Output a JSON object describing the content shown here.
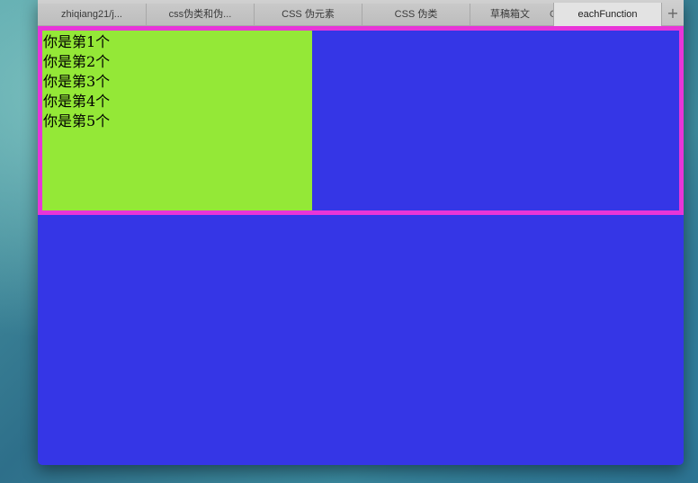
{
  "tabs": [
    {
      "label": "zhiqiang21/j..."
    },
    {
      "label": "css伪类和伪..."
    },
    {
      "label": "CSS 伪元素"
    },
    {
      "label": "CSS 伪类"
    },
    {
      "label": "草稿箱文",
      "extra": "C"
    },
    {
      "label": "eachFunction",
      "active": true
    }
  ],
  "new_tab_label": "+",
  "content": {
    "items": [
      "你是第1个",
      "你是第2个",
      "你是第3个",
      "你是第4个",
      "你是第5个"
    ]
  },
  "colors": {
    "page_background": "#3536e6",
    "outer_border": "#e835d8",
    "green_box": "#94e837"
  }
}
